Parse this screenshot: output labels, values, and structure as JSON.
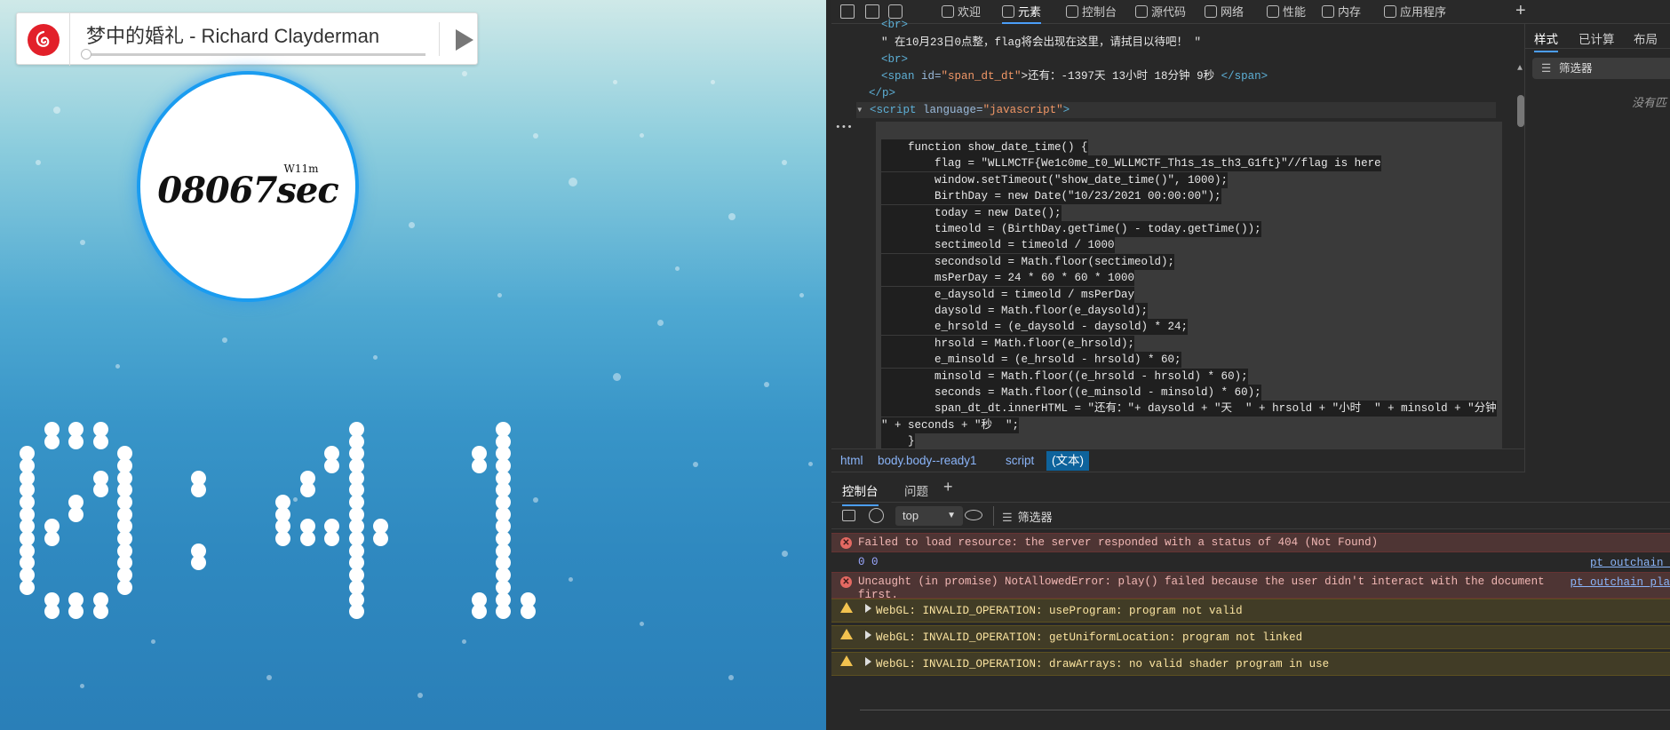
{
  "player": {
    "song_title": "梦中的婚礼 - Richard Clayderman",
    "progress": 0
  },
  "avatar": {
    "logo_top": "W11m",
    "logo_text": "08067sec"
  },
  "clock": {
    "time_text": "0:41"
  },
  "devtools": {
    "toolbar_tabs": [
      {
        "label": "欢迎",
        "icon": "home-icon"
      },
      {
        "label": "元素",
        "icon": "code-icon"
      },
      {
        "label": "控制台",
        "icon": "console-icon"
      },
      {
        "label": "源代码",
        "icon": "bug-icon"
      },
      {
        "label": "网络",
        "icon": "wifi-icon"
      },
      {
        "label": "性能",
        "icon": "gauge-icon"
      },
      {
        "label": "内存",
        "icon": "gear-icon"
      },
      {
        "label": "应用程序",
        "icon": "app-icon"
      }
    ],
    "add_tab": "+",
    "elements": {
      "line0": "<br>",
      "line1_text": "\" 在10月23日0点整，flag将会出现在这里，请拭目以待吧！ \"",
      "line2": "<br>",
      "line3_tag_open": "<span ",
      "line3_attr": "id=",
      "line3_val": "\"span_dt_dt\"",
      "line3_text": ">还有：-1397天 13小时 18分钟 9秒 ",
      "line3_close": "</span>",
      "line4": "</p>",
      "line5_tag": "<script ",
      "line5_attr": "language=",
      "line5_val": "\"javascript\"",
      "line5_end": ">",
      "dots": "•••",
      "js": [
        "    function show_date_time() {",
        "        flag = \"WLLMCTF{We1c0me_t0_WLLMCTF_Th1s_1s_th3_G1ft}\"//flag is here",
        "        window.setTimeout(\"show_date_time()\", 1000);",
        "        BirthDay = new Date(\"10/23/2021 00:00:00\");",
        "        today = new Date();",
        "        timeold = (BirthDay.getTime() - today.getTime());",
        "        sectimeold = timeold / 1000",
        "        secondsold = Math.floor(sectimeold);",
        "        msPerDay = 24 * 60 * 60 * 1000",
        "        e_daysold = timeold / msPerDay",
        "        daysold = Math.floor(e_daysold);",
        "        e_hrsold = (e_daysold - daysold) * 24;",
        "        hrsold = Math.floor(e_hrsold);",
        "        e_minsold = (e_hrsold - hrsold) * 60;",
        "        minsold = Math.floor((e_hrsold - hrsold) * 60);",
        "        seconds = Math.floor((e_minsold - minsold) * 60);",
        "        span_dt_dt.innerHTML = \"还有：\"+ daysold + \"天  \" + hrsold + \"小时  \" + minsold + \"分钟",
        "\" + seconds + \"秒  \";",
        "    }"
      ]
    },
    "breadcrumbs": [
      "html",
      "body.body--ready1",
      "script",
      "(文本)"
    ],
    "styles": {
      "tabs": [
        "样式",
        "已计算",
        "布局"
      ],
      "filter": "筛选器",
      "nomatch": "没有匹"
    },
    "console": {
      "tabs": [
        "控制台",
        "问题"
      ],
      "add": "+",
      "context": "top",
      "filter": "筛选器",
      "messages": [
        {
          "type": "error",
          "text": "Failed to load resource: the server responded with a status of 404 (Not Found)",
          "src": ""
        },
        {
          "type": "log",
          "text": "0 0",
          "src": "pt_outchain_"
        },
        {
          "type": "error",
          "text": "Uncaught (in promise) NotAllowedError: play() failed because the user didn't interact with the document\nfirst.",
          "src": "pt_outchain_pla"
        },
        {
          "type": "warn",
          "text": "WebGL: INVALID_OPERATION: useProgram: program not valid",
          "src": ""
        },
        {
          "type": "warn",
          "text": "WebGL: INVALID_OPERATION: getUniformLocation: program not linked",
          "src": ""
        },
        {
          "type": "warn",
          "text": "WebGL: INVALID_OPERATION: drawArrays: no valid shader program in use",
          "src": ""
        }
      ]
    }
  }
}
